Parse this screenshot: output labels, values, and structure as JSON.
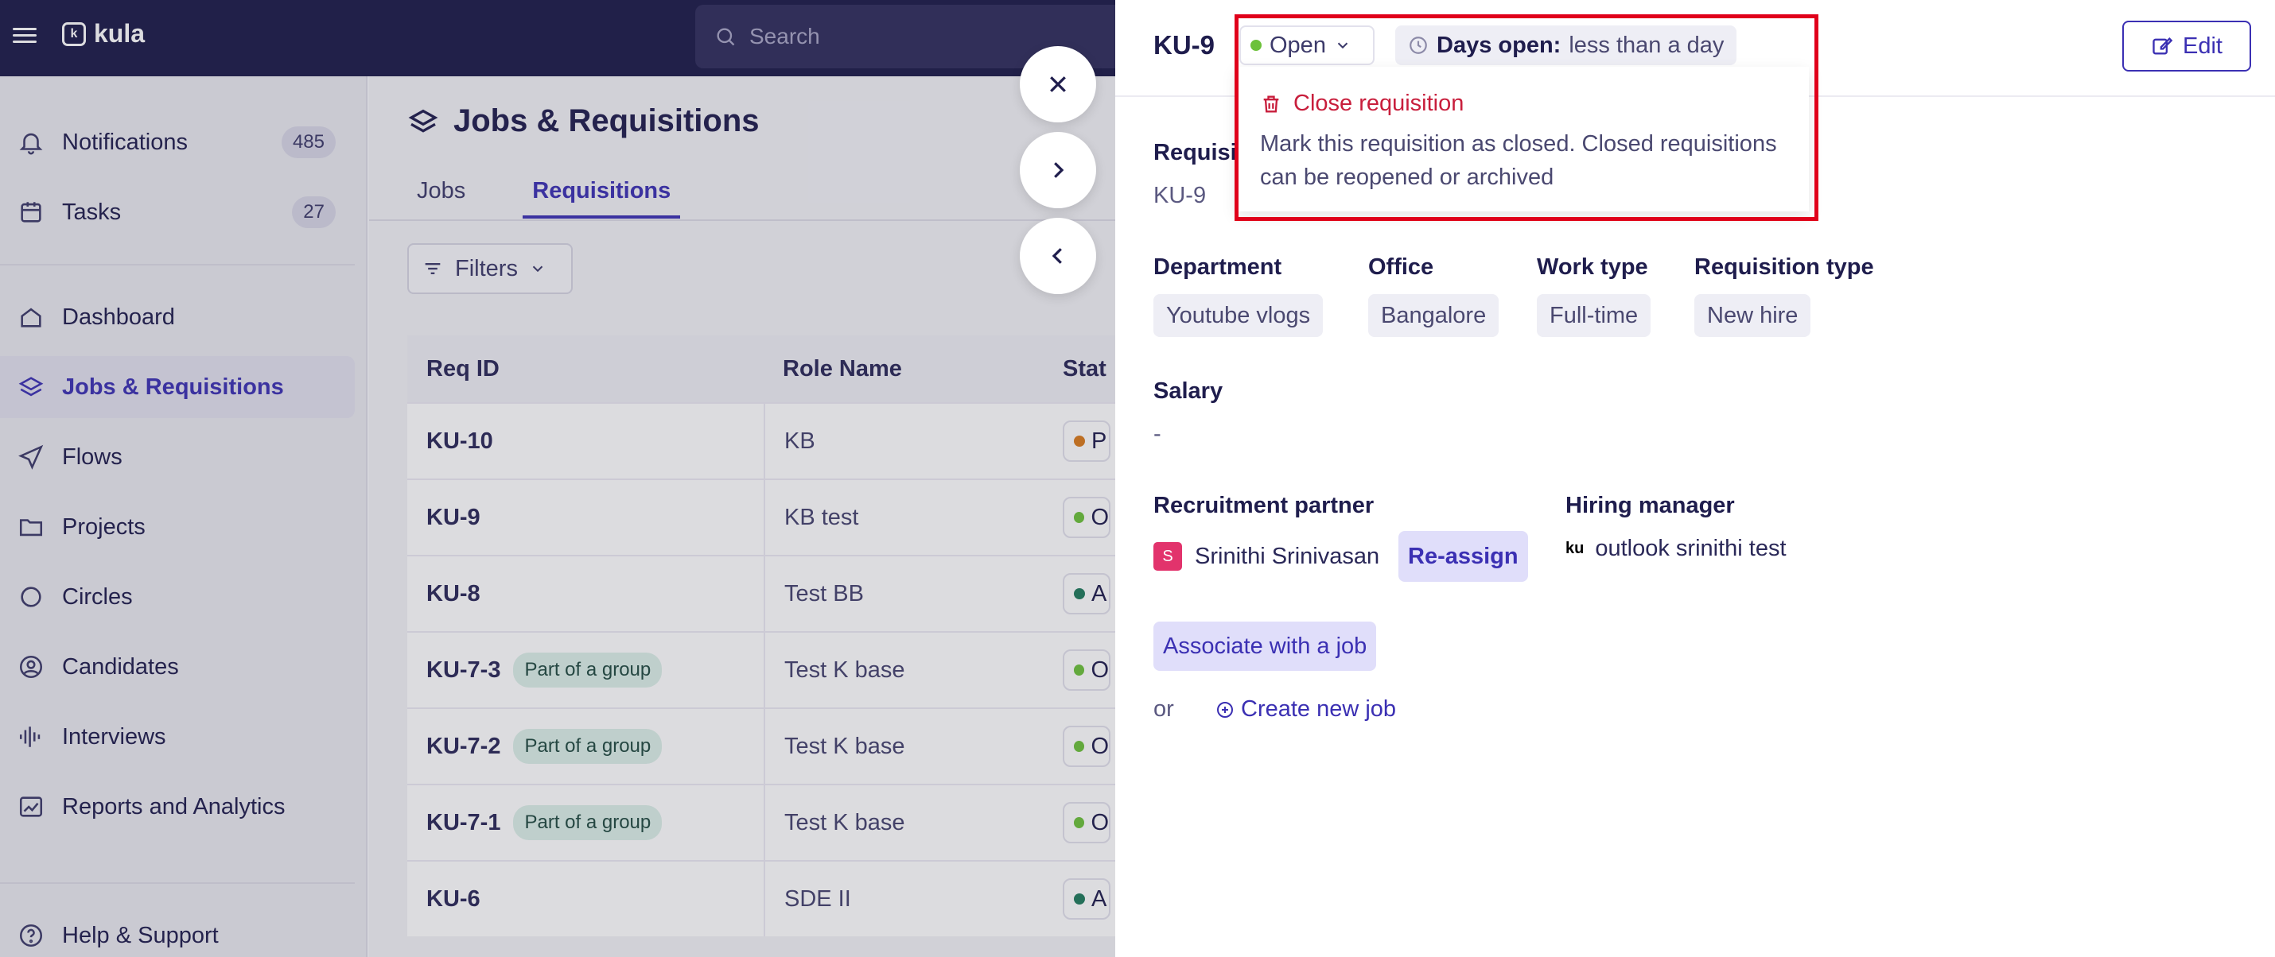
{
  "app": {
    "logo_text": "kula"
  },
  "search": {
    "placeholder": "Search"
  },
  "sidebar": {
    "items": [
      {
        "label": "Notifications",
        "count": "485",
        "icon": "bell-icon"
      },
      {
        "label": "Tasks",
        "count": "27",
        "icon": "calendar-icon"
      },
      {
        "label": "Dashboard",
        "icon": "home-icon"
      },
      {
        "label": "Jobs & Requisitions",
        "icon": "layers-icon",
        "active": true
      },
      {
        "label": "Flows",
        "icon": "send-icon"
      },
      {
        "label": "Projects",
        "icon": "folder-icon"
      },
      {
        "label": "Circles",
        "icon": "circles-icon"
      },
      {
        "label": "Candidates",
        "icon": "user-circle-icon"
      },
      {
        "label": "Interviews",
        "icon": "waveform-icon"
      },
      {
        "label": "Reports and Analytics",
        "icon": "chart-icon"
      },
      {
        "label": "Help & Support",
        "icon": "help-icon"
      }
    ]
  },
  "main": {
    "title": "Jobs & Requisitions",
    "tabs": [
      {
        "label": "Jobs"
      },
      {
        "label": "Requisitions",
        "active": true
      }
    ],
    "filters_label": "Filters",
    "table": {
      "headers": [
        "Req ID",
        "Role Name",
        "Stat"
      ],
      "rows": [
        {
          "id": "KU-10",
          "role": "KB",
          "status_letter": "P",
          "dot": "#d97a1c"
        },
        {
          "id": "KU-9",
          "role": "KB test",
          "status_letter": "O",
          "dot": "#6cc13a"
        },
        {
          "id": "KU-8",
          "role": "Test BB",
          "status_letter": "A",
          "dot": "#1f7a5c"
        },
        {
          "id": "KU-7-3",
          "badge": "Part of a group",
          "role": "Test K base",
          "status_letter": "O",
          "dot": "#6cc13a"
        },
        {
          "id": "KU-7-2",
          "badge": "Part of a group",
          "role": "Test K base",
          "status_letter": "O",
          "dot": "#6cc13a"
        },
        {
          "id": "KU-7-1",
          "badge": "Part of a group",
          "role": "Test K base",
          "status_letter": "O",
          "dot": "#6cc13a"
        },
        {
          "id": "KU-6",
          "role": "SDE II",
          "status_letter": "A",
          "dot": "#1f7a5c"
        }
      ]
    }
  },
  "panel": {
    "id": "KU-9",
    "status": "Open",
    "days_label": "Days open:",
    "days_value": "less than a day",
    "edit_label": "Edit",
    "dropdown": {
      "close_label": "Close requisition",
      "close_desc": "Mark this requisition as closed. Closed requisitions can be reopened or archived"
    },
    "requisition_label": "Requisiti",
    "requisition_id": "KU-9",
    "department": {
      "label": "Department",
      "value": "Youtube vlogs"
    },
    "office": {
      "label": "Office",
      "value": "Bangalore"
    },
    "work_type": {
      "label": "Work type",
      "value": "Full-time"
    },
    "requisition_type": {
      "label": "Requisition type",
      "value": "New hire"
    },
    "salary": {
      "label": "Salary",
      "value": "-"
    },
    "recruitment_partner": {
      "label": "Recruitment partner",
      "avatar": "S",
      "name": "Srinithi Srinivasan",
      "reassign": "Re-assign"
    },
    "hiring_manager": {
      "label": "Hiring manager",
      "avatar": "ku",
      "name": "outlook srinithi test"
    },
    "associate_label": "Associate with a job",
    "or_label": "or",
    "create_label": "Create new job"
  },
  "colors": {
    "accent": "#3b30b3",
    "danger": "#c81e3c",
    "highlight": "#e0001b",
    "topbar": "#1c1a48"
  }
}
